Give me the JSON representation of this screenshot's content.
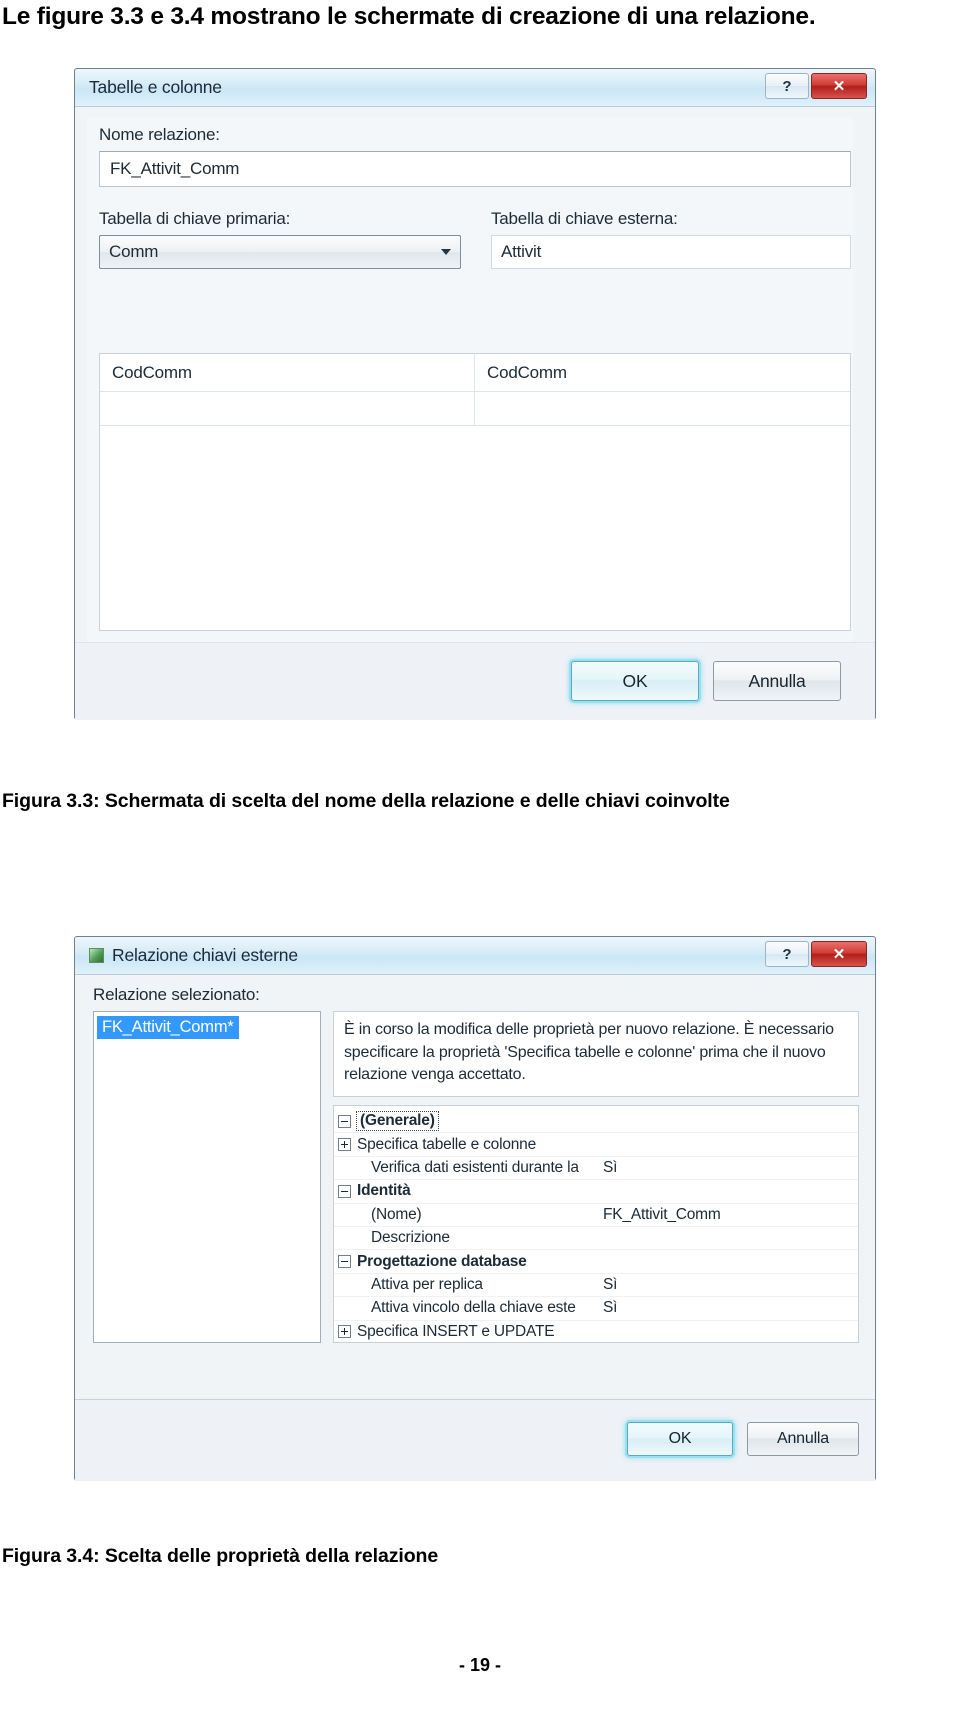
{
  "document": {
    "intro": "Le figure 3.3 e 3.4 mostrano le schermate di creazione di una relazione.",
    "caption_33": "Figura 3.3: Schermata di scelta del nome della relazione e delle chiavi coinvolte",
    "caption_34": "Figura 3.4:  Scelta delle proprietà della relazione",
    "page_number": "- 19 -"
  },
  "dialog_tables_columns": {
    "title": "Tabelle e colonne",
    "help_button": "?",
    "close_button": "✕",
    "relation_name_label": "Nome relazione:",
    "relation_name_value": "FK_Attivit_Comm",
    "primary_key_table_label": "Tabella di chiave primaria:",
    "primary_key_table_value": "Comm",
    "foreign_key_table_label": "Tabella di chiave esterna:",
    "foreign_key_table_value": "Attivit",
    "grid": {
      "primary_column": "CodComm",
      "foreign_column": "CodComm"
    },
    "ok_label": "OK",
    "cancel_label": "Annulla"
  },
  "dialog_foreign_key_relationship": {
    "title": "Relazione chiavi esterne",
    "help_button": "?",
    "close_button": "✕",
    "selected_label": "Relazione selezionato:",
    "selected_item": "FK_Attivit_Comm*",
    "description": "È in corso la modifica delle proprietà per nuovo relazione.  È necessario specificare la proprietà 'Specifica tabelle e colonne' prima che il nuovo relazione venga accettato.",
    "properties": [
      {
        "expander": "minus",
        "name": "(Generale)",
        "value": "",
        "group": true,
        "focused": true
      },
      {
        "expander": "plus",
        "name": "Specifica tabelle e colonne",
        "value": "",
        "group": false
      },
      {
        "expander": "none",
        "name": "Verifica dati esistenti durante la",
        "value": "Sì",
        "group": false
      },
      {
        "expander": "minus",
        "name": "Identità",
        "value": "",
        "group": true
      },
      {
        "expander": "none",
        "name": "(Nome)",
        "value": "FK_Attivit_Comm",
        "group": false
      },
      {
        "expander": "none",
        "name": "Descrizione",
        "value": "",
        "group": false
      },
      {
        "expander": "minus",
        "name": "Progettazione database",
        "value": "",
        "group": true
      },
      {
        "expander": "none",
        "name": "Attiva per replica",
        "value": "Sì",
        "group": false
      },
      {
        "expander": "none",
        "name": "Attiva vincolo della chiave este",
        "value": "Sì",
        "group": false
      },
      {
        "expander": "plus",
        "name": "Specifica INSERT e UPDATE",
        "value": "",
        "group": false
      }
    ],
    "ok_label": "OK",
    "cancel_label": "Annulla"
  },
  "colors": {
    "selection_blue": "#3399ff",
    "close_red": "#c3302a",
    "default_button_glow": "#9be0ee",
    "titlebar_blue": "#cbe6f6"
  }
}
